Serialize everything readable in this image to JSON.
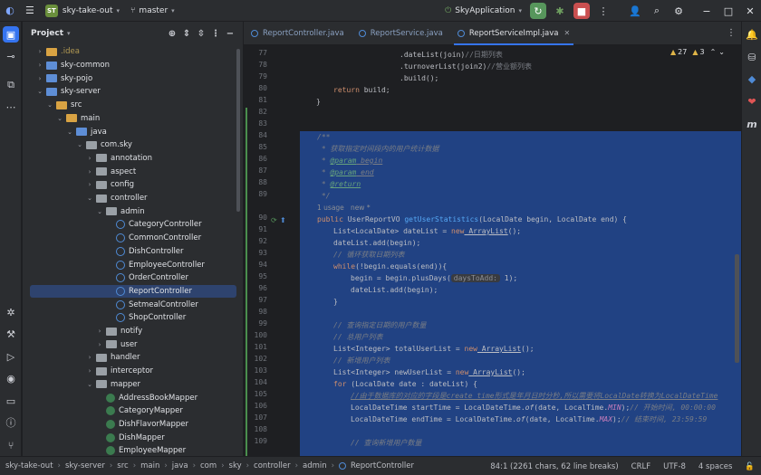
{
  "titlebar": {
    "project_badge": "ST",
    "project_name": "sky-take-out",
    "branch": "master",
    "run_config": "SkyApplication"
  },
  "project_panel": {
    "title": "Project",
    "tree": [
      {
        "label": ".idea",
        "depth": 2,
        "kind": "folder-idea",
        "state": "collapsed"
      },
      {
        "label": "sky-common",
        "depth": 2,
        "kind": "folder-module",
        "state": "collapsed"
      },
      {
        "label": "sky-pojo",
        "depth": 2,
        "kind": "folder-module",
        "state": "collapsed"
      },
      {
        "label": "sky-server",
        "depth": 2,
        "kind": "folder-module",
        "state": "expanded"
      },
      {
        "label": "src",
        "depth": 3,
        "kind": "folder",
        "state": "expanded"
      },
      {
        "label": "main",
        "depth": 4,
        "kind": "folder",
        "state": "expanded"
      },
      {
        "label": "java",
        "depth": 5,
        "kind": "folder-src",
        "state": "expanded"
      },
      {
        "label": "com.sky",
        "depth": 6,
        "kind": "folder-pkg",
        "state": "expanded"
      },
      {
        "label": "annotation",
        "depth": 7,
        "kind": "folder-pkg",
        "state": "collapsed"
      },
      {
        "label": "aspect",
        "depth": 7,
        "kind": "folder-pkg",
        "state": "collapsed"
      },
      {
        "label": "config",
        "depth": 7,
        "kind": "folder-pkg",
        "state": "collapsed"
      },
      {
        "label": "controller",
        "depth": 7,
        "kind": "folder-pkg",
        "state": "expanded"
      },
      {
        "label": "admin",
        "depth": 8,
        "kind": "folder-pkg",
        "state": "expanded"
      },
      {
        "label": "CategoryController",
        "depth": 9,
        "kind": "class",
        "state": "leaf"
      },
      {
        "label": "CommonController",
        "depth": 9,
        "kind": "class",
        "state": "leaf"
      },
      {
        "label": "DishController",
        "depth": 9,
        "kind": "class",
        "state": "leaf"
      },
      {
        "label": "EmployeeController",
        "depth": 9,
        "kind": "class",
        "state": "leaf"
      },
      {
        "label": "OrderController",
        "depth": 9,
        "kind": "class",
        "state": "leaf"
      },
      {
        "label": "ReportController",
        "depth": 9,
        "kind": "class",
        "state": "leaf",
        "selected": true
      },
      {
        "label": "SetmealController",
        "depth": 9,
        "kind": "class",
        "state": "leaf"
      },
      {
        "label": "ShopController",
        "depth": 9,
        "kind": "class",
        "state": "leaf"
      },
      {
        "label": "notify",
        "depth": 8,
        "kind": "folder-pkg",
        "state": "collapsed"
      },
      {
        "label": "user",
        "depth": 8,
        "kind": "folder-pkg",
        "state": "collapsed"
      },
      {
        "label": "handler",
        "depth": 7,
        "kind": "folder-pkg",
        "state": "collapsed"
      },
      {
        "label": "interceptor",
        "depth": 7,
        "kind": "folder-pkg",
        "state": "collapsed"
      },
      {
        "label": "mapper",
        "depth": 7,
        "kind": "folder-pkg",
        "state": "expanded"
      },
      {
        "label": "AddressBookMapper",
        "depth": 8,
        "kind": "interface",
        "state": "leaf"
      },
      {
        "label": "CategoryMapper",
        "depth": 8,
        "kind": "interface",
        "state": "leaf"
      },
      {
        "label": "DishFlavorMapper",
        "depth": 8,
        "kind": "interface",
        "state": "leaf"
      },
      {
        "label": "DishMapper",
        "depth": 8,
        "kind": "interface",
        "state": "leaf"
      },
      {
        "label": "EmployeeMapper",
        "depth": 8,
        "kind": "interface",
        "state": "leaf"
      }
    ]
  },
  "tabs": [
    {
      "label": "ReportController.java",
      "active": false
    },
    {
      "label": "ReportService.java",
      "active": false
    },
    {
      "label": "ReportServiceImpl.java",
      "active": true
    }
  ],
  "editor": {
    "warnings": "27",
    "weak_warnings": "3",
    "line_numbers": [
      "77",
      "78",
      "79",
      "80",
      "81",
      "82",
      "83",
      "84",
      "85",
      "86",
      "87",
      "88",
      "89",
      "",
      "90",
      "91",
      "92",
      "93",
      "94",
      "95",
      "96",
      "97",
      "98",
      "99",
      "100",
      "101",
      "102",
      "103",
      "104",
      "105",
      "106",
      "107",
      "108",
      "109"
    ],
    "usages_hint": "1 usage   new *",
    "param_hint": "daysToAdd:",
    "code": {
      "l77": ".dateList(join)",
      "l77c": "//日期列表",
      "l78": ".turnoverList(join2)",
      "l78c": "//营业额列表",
      "l79": ".build();",
      "l80a": "return",
      "l80b": " build;",
      "l81": "}",
      "l85": "/**",
      "l86": " * 获取指定时间段内的用户统计数据",
      "l87a": " * ",
      "l87b": "@param",
      "l87c": " begin",
      "l88a": " * ",
      "l88b": "@param",
      "l88c": " end",
      "l89a": " * ",
      "l89b": "@return",
      "l89d": " */",
      "l90a": "public",
      "l90b": " UserReportVO ",
      "l90c": "getUserStatistics",
      "l90d": "(LocalDate begin, LocalDate end) {",
      "l91a": "List<LocalDate> dateList = ",
      "l91b": "new",
      "l91c": " ArrayList",
      "l91d": "();",
      "l92": "dateList.add(begin);",
      "l93": "// 循环获取日期列表",
      "l94a": "while",
      "l94b": "(!begin.equals(end)){",
      "l95a": "begin = begin.plusDays(",
      "l95b": " 1);",
      "l96": "dateList.add(begin);",
      "l97": "}",
      "l99": "// 查询指定日期的用户数量",
      "l100": "// 总用户列表",
      "l101a": "List<Integer> totalUserList = ",
      "l101b": "new",
      "l101c": " ArrayList",
      "l101d": "();",
      "l102": "// 新增用户列表",
      "l103a": "List<Integer> newUserList = ",
      "l103b": "new",
      "l103c": " ArrayList",
      "l103d": "();",
      "l104a": "for",
      "l104b": " (LocalDate date : dateList) {",
      "l105": "//由于数据库的对应的字段是create_time形式是年月日时分秒,所以需要将LocalDate转换为LocalDateTime",
      "l106a": "LocalDateTime startTime = LocalDateTime.",
      "l106b": "of",
      "l106c": "(date, LocalTime.",
      "l106d": "MIN",
      "l106e": ");",
      "l106f": "// 开始时间, 00:00:00",
      "l107a": "LocalDateTime endTime = LocalDateTime.",
      "l107b": "of",
      "l107c": "(date, LocalTime.",
      "l107d": "MAX",
      "l107e": ");",
      "l107f": "// 结束时间, 23:59:59",
      "l109": "// 查询新增用户数量"
    }
  },
  "statusbar": {
    "breadcrumbs": [
      "sky-take-out",
      "sky-server",
      "src",
      "main",
      "java",
      "com",
      "sky",
      "controller",
      "admin",
      "ReportController"
    ],
    "position": "84:1 (2261 chars, 62 line breaks)",
    "line_separator": "CRLF",
    "encoding": "UTF-8",
    "indent": "4 spaces"
  },
  "colors": {
    "accent": "#3574f0",
    "selection": "#214283",
    "run": "#57965c",
    "stop": "#c94f4f"
  }
}
